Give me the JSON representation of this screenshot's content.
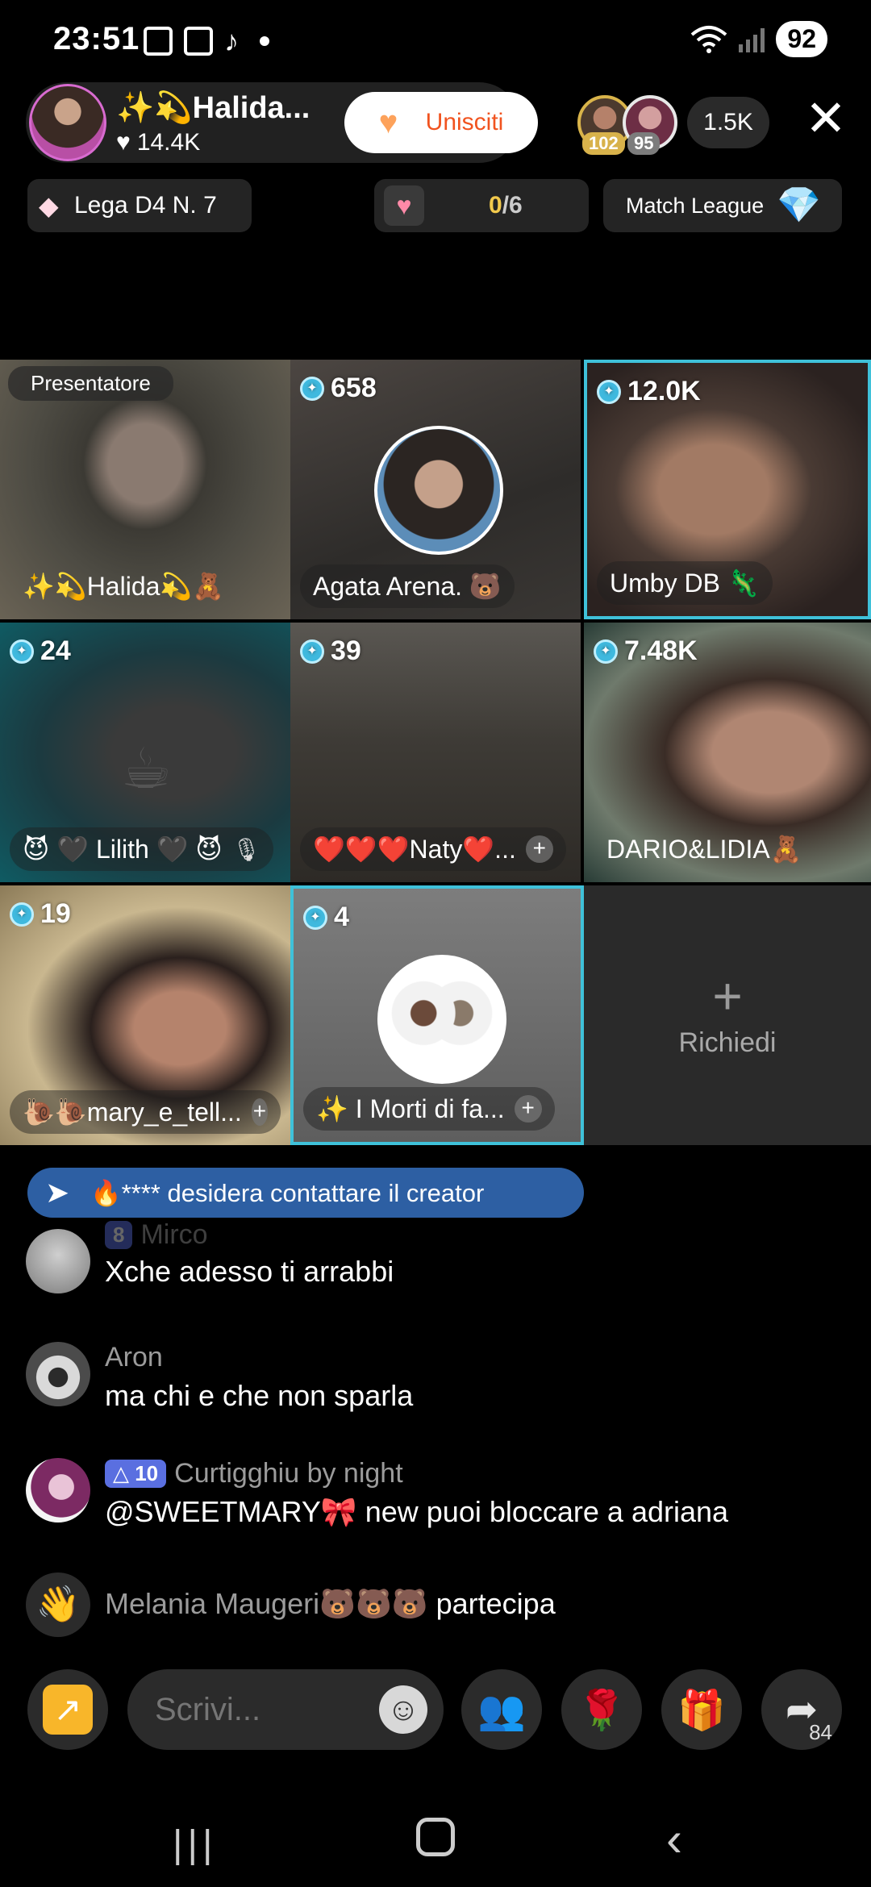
{
  "status": {
    "time": "23:51",
    "battery": "92",
    "wifi_icon": "wifi-icon",
    "signal_icon": "signal-icon"
  },
  "header": {
    "host_name": "✨💫Halida...",
    "host_likes": "14.4K",
    "join_label": "Unisciti",
    "viewer_badges": [
      "102",
      "95"
    ],
    "viewer_count": "1.5K"
  },
  "info_row": {
    "league": "Lega D4 N. 7",
    "progress_current": "0",
    "progress_total": "/6",
    "match_league": "Match League"
  },
  "grid": {
    "presenter_tag": "Presentatore",
    "tiles": [
      {
        "coins": "",
        "name": "✨💫Halida💫🧸"
      },
      {
        "coins": "658",
        "name": "Agata Arena. 🐻"
      },
      {
        "coins": "12.0K",
        "name": "Umby DB 🦎"
      },
      {
        "coins": "24",
        "name": "😈 🖤 Lilith 🖤 😈"
      },
      {
        "coins": "39",
        "name": "❤️❤️❤️Naty❤️..."
      },
      {
        "coins": "7.48K",
        "name": "DARIO&LIDIA🧸"
      },
      {
        "coins": "19",
        "name": "🐌🐌mary_e_tell..."
      },
      {
        "coins": "4",
        "name": "✨ I Morti di fa..."
      }
    ],
    "request_label": "Richiedi"
  },
  "notice": {
    "text": "🔥**** desidera contattare il creator"
  },
  "comments": [
    {
      "user": "Mirco",
      "level": "8",
      "text": "Xche adesso ti arrabbi"
    },
    {
      "user": "Aron",
      "text": "ma chi e che non sparla"
    },
    {
      "user": "Curtigghiu by night",
      "level": "10",
      "text": "@SWEETMARY🎀 new puoi bloccare a adriana"
    },
    {
      "user": "Melania Maugeri🐻🐻🐻",
      "text": "partecipa"
    }
  ],
  "bottom": {
    "write_placeholder": "Scrivi...",
    "share_count": "84"
  },
  "colors": {
    "accent_cyan": "#3fc1d9",
    "join_orange": "#f1531f",
    "notice_blue": "#2d5fa3",
    "level_badge": "#5a6fe0"
  }
}
